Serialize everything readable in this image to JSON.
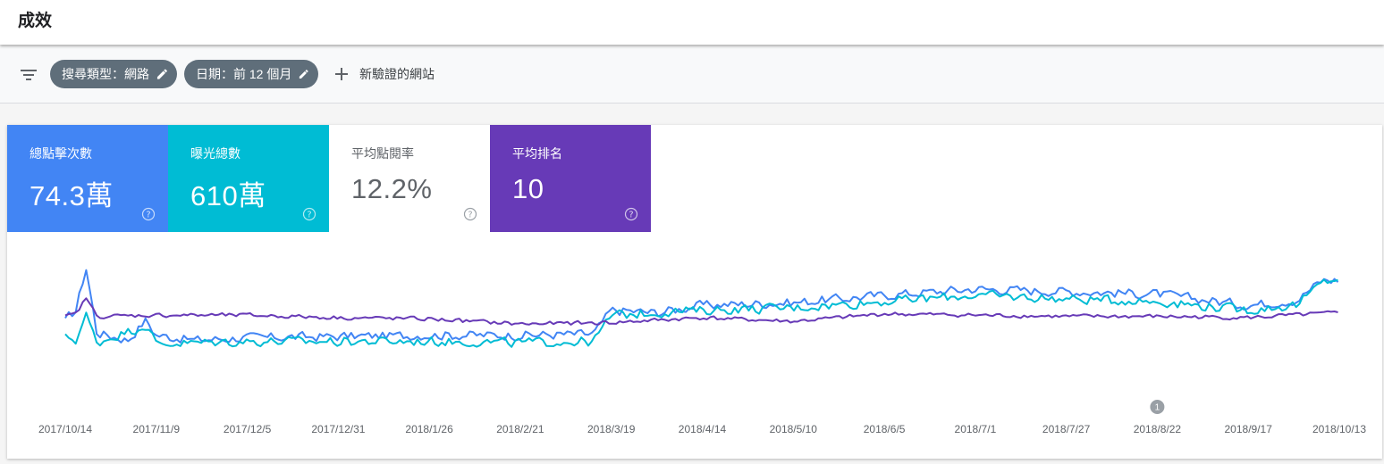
{
  "page": {
    "title": "成效"
  },
  "filters": {
    "chips": [
      {
        "label": "搜尋類型：網路",
        "icon": "edit-icon"
      },
      {
        "label": "日期：前 12 個月",
        "icon": "edit-icon"
      }
    ],
    "add_site_label": "新驗證的網站",
    "add_site_icon": "plus-icon",
    "filter_icon": "filter-list-icon"
  },
  "metrics": [
    {
      "label": "總點擊次數",
      "value": "74.3萬",
      "color": "#4285f4",
      "selected": true
    },
    {
      "label": "曝光總數",
      "value": "610萬",
      "color": "#00bcd4",
      "selected": true
    },
    {
      "label": "平均點閱率",
      "value": "12.2%",
      "color": "#ffffff",
      "selected": false
    },
    {
      "label": "平均排名",
      "value": "10",
      "color": "#673ab7",
      "selected": true
    }
  ],
  "chart_data": {
    "type": "line",
    "x_tick_labels": [
      "2017/10/14",
      "2017/11/9",
      "2017/12/5",
      "2017/12/31",
      "2018/1/26",
      "2018/2/21",
      "2018/3/19",
      "2018/4/14",
      "2018/5/10",
      "2018/6/5",
      "2018/7/1",
      "2018/7/27",
      "2018/8/22",
      "2018/9/17",
      "2018/10/13"
    ],
    "annotation": {
      "label": "1",
      "date": "2018/8/22"
    },
    "grid": false,
    "y_axis_labels_visible": false,
    "series": [
      {
        "name": "總點擊次數",
        "color": "#4285f4",
        "points": [
          [
            "2017/10/14",
            0.58
          ],
          [
            "2017/10/17",
            0.66
          ],
          [
            "2017/10/20",
            1.0
          ],
          [
            "2017/10/23",
            0.48
          ],
          [
            "2017/11/1",
            0.42
          ],
          [
            "2017/11/6",
            0.58
          ],
          [
            "2017/11/9",
            0.46
          ],
          [
            "2017/11/20",
            0.42
          ],
          [
            "2017/12/5",
            0.44
          ],
          [
            "2017/12/31",
            0.45
          ],
          [
            "2018/1/26",
            0.46
          ],
          [
            "2018/2/21",
            0.46
          ],
          [
            "2018/3/14",
            0.47
          ],
          [
            "2018/3/19",
            0.66
          ],
          [
            "2018/4/1",
            0.64
          ],
          [
            "2018/4/14",
            0.7
          ],
          [
            "2018/5/10",
            0.72
          ],
          [
            "2018/6/5",
            0.78
          ],
          [
            "2018/7/1",
            0.83
          ],
          [
            "2018/7/27",
            0.81
          ],
          [
            "2018/8/22",
            0.79
          ],
          [
            "2018/9/17",
            0.7
          ],
          [
            "2018/10/1",
            0.74
          ],
          [
            "2018/10/8",
            0.9
          ],
          [
            "2018/10/13",
            0.9
          ]
        ]
      },
      {
        "name": "曝光總數",
        "color": "#00bcd4",
        "points": [
          [
            "2017/10/14",
            0.45
          ],
          [
            "2017/10/17",
            0.42
          ],
          [
            "2017/10/20",
            0.62
          ],
          [
            "2017/10/23",
            0.4
          ],
          [
            "2017/11/6",
            0.54
          ],
          [
            "2017/11/9",
            0.39
          ],
          [
            "2017/12/5",
            0.41
          ],
          [
            "2017/12/31",
            0.41
          ],
          [
            "2018/1/26",
            0.41
          ],
          [
            "2018/2/21",
            0.4
          ],
          [
            "2018/3/14",
            0.41
          ],
          [
            "2018/3/19",
            0.62
          ],
          [
            "2018/4/14",
            0.66
          ],
          [
            "2018/5/10",
            0.68
          ],
          [
            "2018/6/5",
            0.73
          ],
          [
            "2018/7/1",
            0.78
          ],
          [
            "2018/7/27",
            0.75
          ],
          [
            "2018/8/22",
            0.73
          ],
          [
            "2018/9/17",
            0.66
          ],
          [
            "2018/10/1",
            0.7
          ],
          [
            "2018/10/8",
            0.88
          ],
          [
            "2018/10/13",
            0.92
          ]
        ]
      },
      {
        "name": "平均排名",
        "color": "#673ab7",
        "points": [
          [
            "2017/10/14",
            0.61
          ],
          [
            "2017/10/17",
            0.63
          ],
          [
            "2017/10/20",
            0.76
          ],
          [
            "2017/10/23",
            0.61
          ],
          [
            "2017/11/9",
            0.62
          ],
          [
            "2017/12/5",
            0.62
          ],
          [
            "2017/12/31",
            0.6
          ],
          [
            "2018/1/26",
            0.59
          ],
          [
            "2018/2/21",
            0.55
          ],
          [
            "2018/3/19",
            0.56
          ],
          [
            "2018/4/14",
            0.6
          ],
          [
            "2018/5/10",
            0.57
          ],
          [
            "2018/6/5",
            0.63
          ],
          [
            "2018/7/1",
            0.62
          ],
          [
            "2018/7/27",
            0.61
          ],
          [
            "2018/8/22",
            0.61
          ],
          [
            "2018/9/17",
            0.6
          ],
          [
            "2018/10/13",
            0.64
          ]
        ]
      }
    ]
  }
}
